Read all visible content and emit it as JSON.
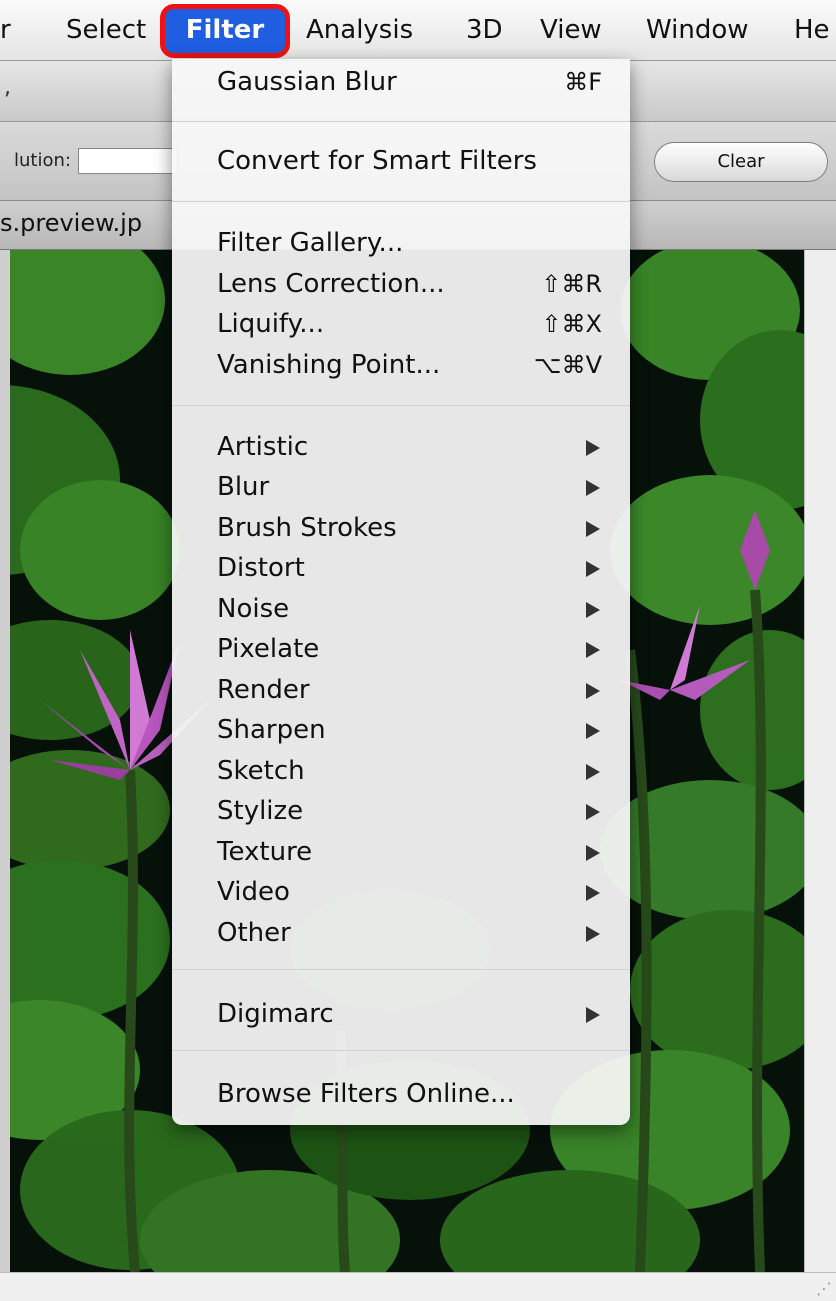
{
  "menubar": {
    "items": [
      "r",
      "Select",
      "Analysis",
      "3D",
      "View",
      "Window",
      "He"
    ],
    "active": "Filter"
  },
  "toolbar": {
    "fragment": ",",
    "resolution_label": "lution:",
    "clear_label": "Clear"
  },
  "document": {
    "tab_title": "s.preview.jp"
  },
  "menu": {
    "gaussian_blur": "Gaussian Blur",
    "gaussian_blur_shortcut": "⌘F",
    "convert_smart": "Convert for Smart Filters",
    "filter_gallery": "Filter Gallery...",
    "lens_correction": "Lens Correction...",
    "lens_correction_shortcut": "⇧⌘R",
    "liquify": "Liquify...",
    "liquify_shortcut": "⇧⌘X",
    "vanishing_point": "Vanishing Point...",
    "vanishing_point_shortcut": "⌥⌘V",
    "submenus": [
      "Artistic",
      "Blur",
      "Brush Strokes",
      "Distort",
      "Noise",
      "Pixelate",
      "Render",
      "Sharpen",
      "Sketch",
      "Stylize",
      "Texture",
      "Video",
      "Other"
    ],
    "digimarc": "Digimarc",
    "browse_online": "Browse Filters Online..."
  }
}
